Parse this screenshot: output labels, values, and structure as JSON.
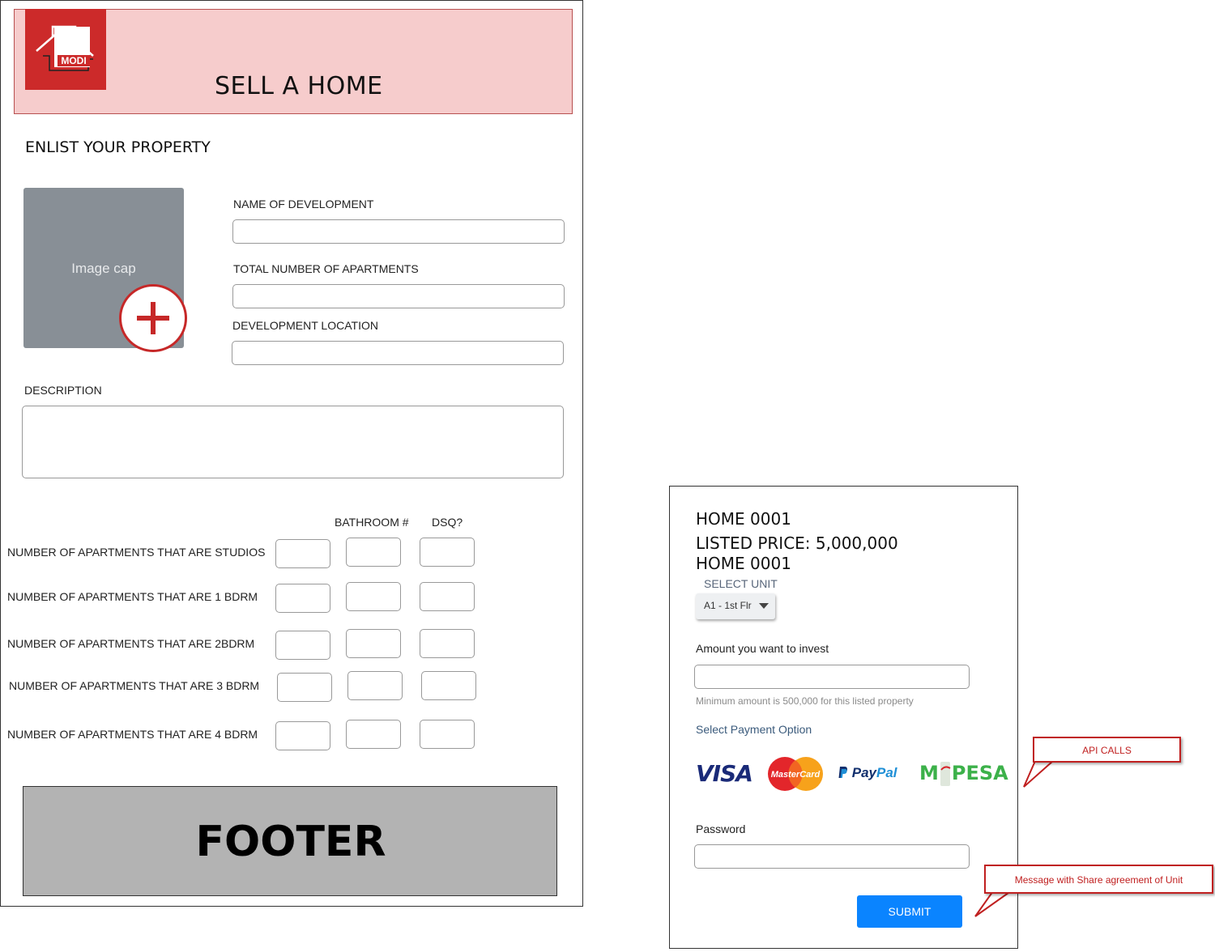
{
  "header": {
    "logo_text": "MODI",
    "title": "SELL A HOME"
  },
  "form": {
    "section_title": "ENLIST YOUR PROPERTY",
    "image_placeholder": "Image cap",
    "name_label": "NAME OF DEVELOPMENT",
    "total_label": "TOTAL NUMBER OF APARTMENTS",
    "location_label": "DEVELOPMENT LOCATION",
    "description_label": "DESCRIPTION",
    "col_bathroom": "BATHROOM #",
    "col_dsq": "DSQ?",
    "rows": [
      {
        "label": "NUMBER OF APARTMENTS THAT ARE STUDIOS"
      },
      {
        "label": "NUMBER OF APARTMENTS THAT ARE 1 BDRM"
      },
      {
        "label": "NUMBER OF APARTMENTS THAT ARE 2BDRM"
      },
      {
        "label": "NUMBER OF APARTMENTS THAT ARE 3 BDRM"
      },
      {
        "label": "NUMBER OF APARTMENTS THAT ARE 4 BDRM"
      }
    ]
  },
  "footer": {
    "text": "FOOTER"
  },
  "invest": {
    "home_id": "HOME 0001",
    "listed_price": "LISTED PRICE: 5,000,000",
    "home_id_2": "HOME 0001",
    "select_unit_label": "SELECT UNIT",
    "selected_unit": "A1 - 1st Flr",
    "amount_label": "Amount you want to invest",
    "min_note": "Minimum amount is 500,000 for this listed property",
    "payment_label": "Select Payment Option",
    "payment_options": {
      "visa": "VISA",
      "mastercard": "MasterCard",
      "paypal_a": "Pay",
      "paypal_b": "Pal",
      "mpesa_a": "M",
      "mpesa_b": "PESA"
    },
    "password_label": "Password",
    "submit_label": "SUBMIT"
  },
  "callouts": {
    "api": "API CALLS",
    "message": "Message with Share agreement of Unit"
  },
  "colors": {
    "header_bg": "#f6cccc",
    "logo_red": "#cc2a2a",
    "submit_blue": "#0a84ff",
    "callout_red": "#c02020",
    "footer_gray": "#b3b3b3"
  }
}
